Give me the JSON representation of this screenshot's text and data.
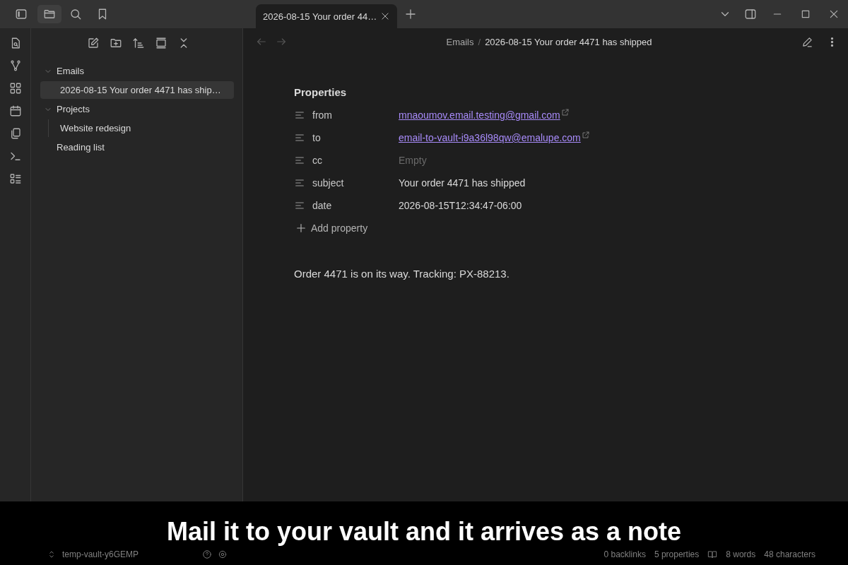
{
  "title_bar": {
    "tabs": [
      {
        "title": "2026-08-15 Your order 44…",
        "selected": true
      }
    ]
  },
  "file_tree": [
    {
      "label": "Emails",
      "kind": "folder",
      "expanded": true,
      "selected": false,
      "children": [
        {
          "label": "2026-08-15 Your order 4471 has ship…",
          "selected": true
        }
      ]
    },
    {
      "label": "Projects",
      "kind": "folder",
      "expanded": true,
      "selected": false,
      "children": [
        {
          "label": "Website redesign",
          "selected": false
        }
      ]
    },
    {
      "label": "Reading list",
      "kind": "file",
      "selected": false
    }
  ],
  "vault_name": "temp-vault-y6GEMP",
  "breadcrumb": [
    "Emails",
    "2026-08-15 Your order 4471 has shipped"
  ],
  "breadcrumb_separator": "/",
  "properties": {
    "title": "Properties",
    "items": [
      {
        "key": "from",
        "value": "mnaoumov.email.testing@gmail.com",
        "kind": "link"
      },
      {
        "key": "to",
        "value": "email-to-vault-i9a36l98qw@emalupe.com",
        "kind": "link"
      },
      {
        "key": "cc",
        "value": "Empty",
        "kind": "empty"
      },
      {
        "key": "subject",
        "value": "Your order 4471 has shipped",
        "kind": "text"
      },
      {
        "key": "date",
        "value": "2026-08-15T12:34:47-06:00",
        "kind": "text"
      }
    ],
    "add_label": "Add property"
  },
  "body": "Order 4471 is on its way. Tracking: PX-88213.",
  "status_bar": [
    "0 backlinks",
    "5 properties",
    "8 words",
    "48 characters"
  ],
  "caption": "Mail it to your vault and it arrives as a note"
}
